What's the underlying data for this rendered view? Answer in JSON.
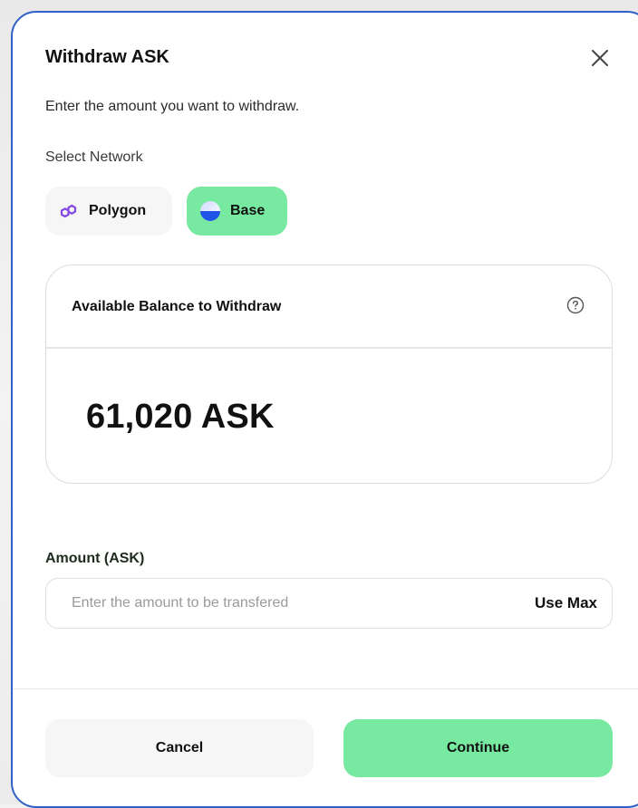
{
  "modal": {
    "title": "Withdraw ASK",
    "subtitle": "Enter the amount you want to withdraw.",
    "close_icon": "close-icon"
  },
  "network": {
    "label": "Select Network",
    "options": [
      {
        "label": "Polygon",
        "icon": "polygon-logo-icon",
        "selected": false
      },
      {
        "label": "Base",
        "icon": "base-logo-icon",
        "selected": true
      }
    ]
  },
  "balance": {
    "title": "Available Balance to Withdraw",
    "help_icon": "help-circle-icon",
    "amount": "61,020 ASK"
  },
  "amount_field": {
    "label": "Amount (ASK)",
    "value": "",
    "placeholder": "Enter the amount to be transfered",
    "use_max_label": "Use Max"
  },
  "actions": {
    "cancel_label": "Cancel",
    "continue_label": "Continue"
  },
  "colors": {
    "accent": "#78e9a0",
    "border_focus": "#2f62c9",
    "polygon_purple": "#8247e5"
  }
}
